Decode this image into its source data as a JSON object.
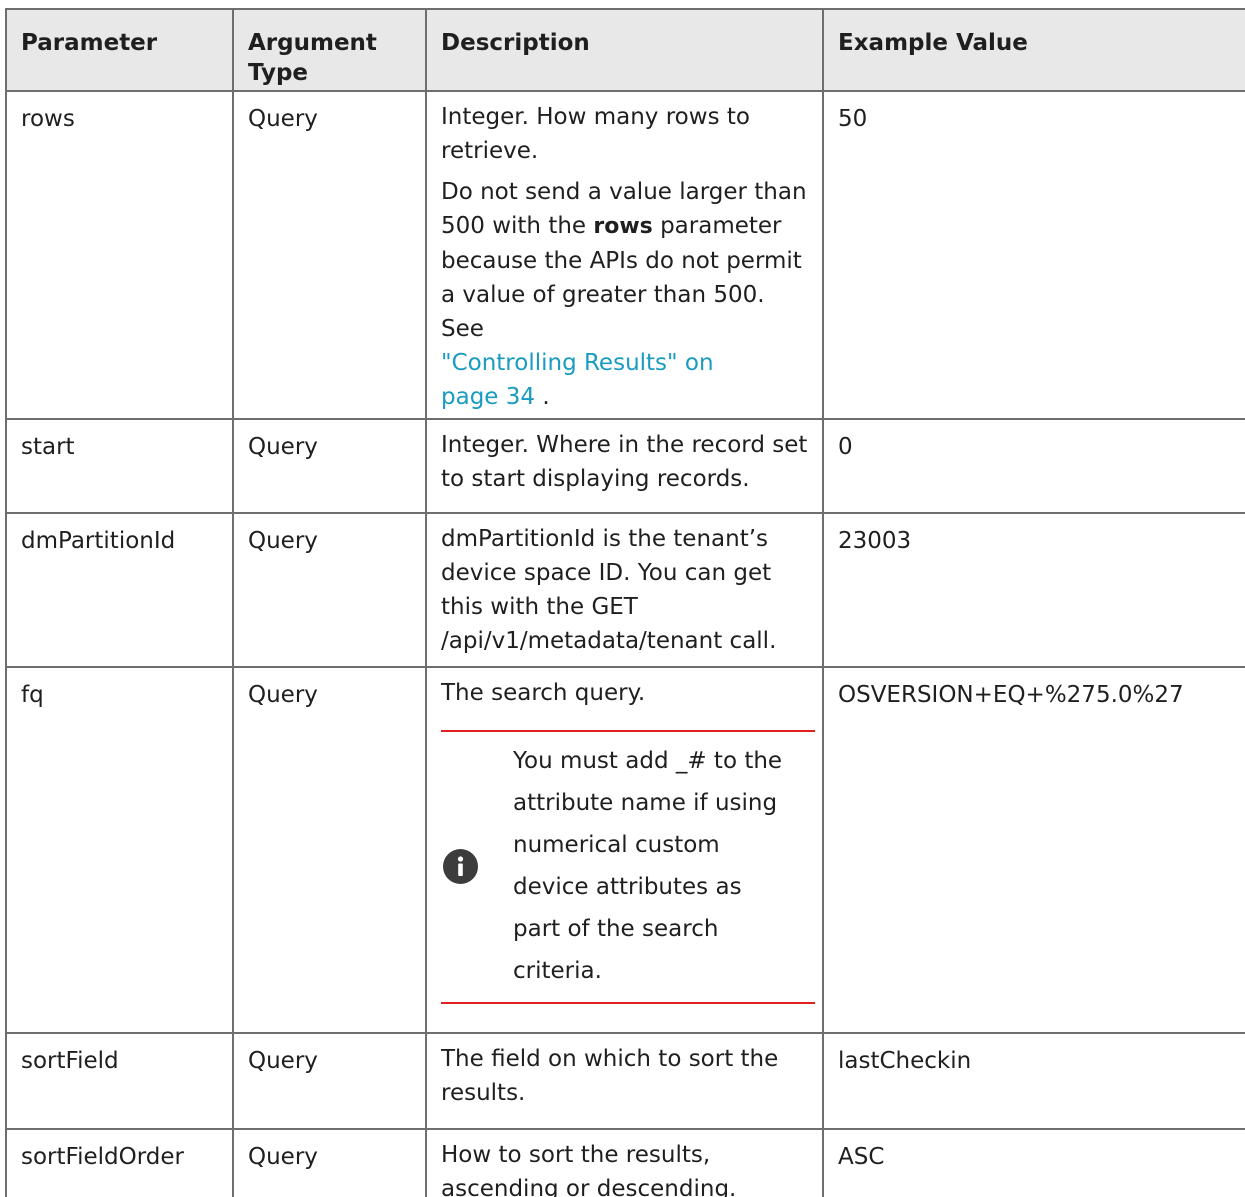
{
  "table": {
    "headers": {
      "parameter": "Parameter",
      "argument_type": [
        "Argument",
        "Type"
      ],
      "description": "Description",
      "example_value": "Example Value"
    },
    "rows": [
      {
        "parameter": "rows",
        "argument_type": "Query",
        "description": {
          "lines_p1": [
            "Integer. How many rows to",
            "retrieve."
          ],
          "p2_before": [
            "Do not send a value larger than",
            "500 with the "
          ],
          "p2_bold": "rows",
          "p2_after": " parameter",
          "p2_rest": [
            "because the APIs do not permit",
            "a value of greater than 500. See"
          ],
          "link_lines": [
            "\"Controlling Results\" on",
            "page 34"
          ],
          "link_suffix": " ."
        },
        "example_value": "50"
      },
      {
        "parameter": "start",
        "argument_type": "Query",
        "description": {
          "lines": [
            "Integer. Where in the record set",
            "to start displaying records."
          ]
        },
        "example_value": "0"
      },
      {
        "parameter": "dmPartitionId",
        "argument_type": "Query",
        "description": {
          "lines": [
            "dmPartitionId is the tenant’s",
            "device space ID. You can get",
            "this with the GET",
            "/api/v1/metadata/tenant call."
          ]
        },
        "example_value": "23003"
      },
      {
        "parameter": "fq",
        "argument_type": "Query",
        "description": {
          "lines": [
            "The search query."
          ],
          "note": {
            "icon": "info-icon",
            "lines": [
              "You must add _# to the",
              "attribute name if using",
              "numerical custom",
              "device attributes as",
              "part of the search",
              "criteria."
            ]
          }
        },
        "example_value": "OSVERSION+EQ+%275.0%27"
      },
      {
        "parameter": "sortField",
        "argument_type": "Query",
        "description": {
          "lines": [
            "The field on which to sort the",
            "results."
          ]
        },
        "example_value": "lastCheckin"
      },
      {
        "parameter": "sortFieldOrder",
        "argument_type": "Query",
        "description": {
          "lines": [
            "How to sort the results,",
            "ascending or descending."
          ]
        },
        "example_value": "ASC"
      }
    ]
  },
  "colors": {
    "header_background": "#e8e8e8",
    "border": "#6e6e6e",
    "link": "#1a9bc2",
    "note_rule": "#e02020",
    "note_icon": "#3c3c3c"
  }
}
